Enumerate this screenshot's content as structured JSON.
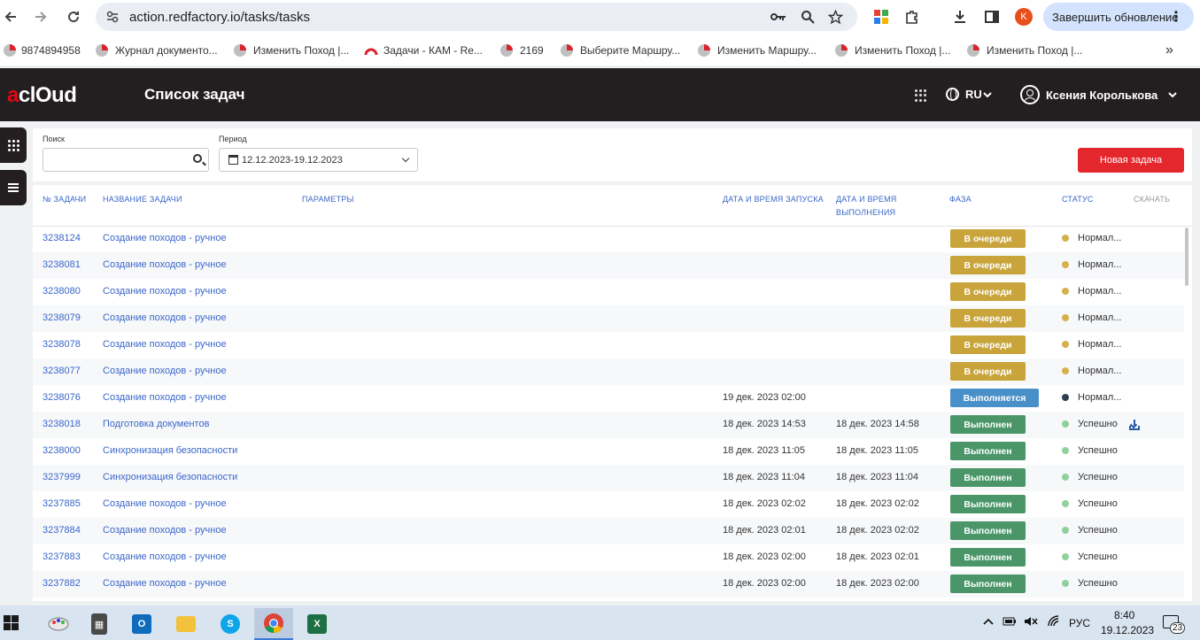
{
  "browser": {
    "url": "action.redfactory.io/tasks/tasks",
    "update_label": "Завершить обновление",
    "profile_initial": "K",
    "bookmarks": [
      {
        "label": "9874894958"
      },
      {
        "label": "Журнал документо..."
      },
      {
        "label": "Изменить Поход |..."
      },
      {
        "label": "Задачи - КАМ - Re..."
      },
      {
        "label": "2169"
      },
      {
        "label": "Выберите Маршру..."
      },
      {
        "label": "Изменить Маршру..."
      },
      {
        "label": "Изменить Поход |..."
      },
      {
        "label": "Изменить Поход |..."
      }
    ],
    "more_label": "»"
  },
  "app": {
    "logo_a": "a",
    "logo_rest": "clOud",
    "title": "Список задач",
    "lang": "RU",
    "user_name": "Ксения Королькова"
  },
  "filters": {
    "search_label": "Поиск",
    "search_value": "",
    "period_label": "Период",
    "period_value": "12.12.2023-19.12.2023",
    "new_task_label": "Новая задача"
  },
  "table": {
    "headers": {
      "id": "№ ЗАДАЧИ",
      "name": "НАЗВАНИЕ ЗАДАЧИ",
      "params": "ПАРАМЕТРЫ",
      "start": "ДАТА И ВРЕМЯ ЗАПУСКА",
      "done_1": "ДАТА И ВРЕМЯ",
      "done_2": "ВЫПОЛНЕНИЯ",
      "phase": "ФАЗА",
      "status": "СТАТУС",
      "download": "СКАЧАТЬ"
    },
    "rows": [
      {
        "id": "3238124",
        "name": "Создание походов - ручное",
        "start": "",
        "done": "",
        "phase": "В очереди",
        "phase_kind": "queue",
        "status": "Нормал...",
        "status_color": "#d6b04a",
        "download": false
      },
      {
        "id": "3238081",
        "name": "Создание походов - ручное",
        "start": "",
        "done": "",
        "phase": "В очереди",
        "phase_kind": "queue",
        "status": "Нормал...",
        "status_color": "#d6b04a",
        "download": false
      },
      {
        "id": "3238080",
        "name": "Создание походов - ручное",
        "start": "",
        "done": "",
        "phase": "В очереди",
        "phase_kind": "queue",
        "status": "Нормал...",
        "status_color": "#d6b04a",
        "download": false
      },
      {
        "id": "3238079",
        "name": "Создание походов - ручное",
        "start": "",
        "done": "",
        "phase": "В очереди",
        "phase_kind": "queue",
        "status": "Нормал...",
        "status_color": "#d6b04a",
        "download": false
      },
      {
        "id": "3238078",
        "name": "Создание походов - ручное",
        "start": "",
        "done": "",
        "phase": "В очереди",
        "phase_kind": "queue",
        "status": "Нормал...",
        "status_color": "#d6b04a",
        "download": false
      },
      {
        "id": "3238077",
        "name": "Создание походов - ручное",
        "start": "",
        "done": "",
        "phase": "В очереди",
        "phase_kind": "queue",
        "status": "Нормал...",
        "status_color": "#d6b04a",
        "download": false
      },
      {
        "id": "3238076",
        "name": "Создание походов - ручное",
        "start": "19 дек. 2023 02:00",
        "done": "",
        "phase": "Выполняется",
        "phase_kind": "running",
        "status": "Нормал...",
        "status_color": "#2c3e50",
        "download": false
      },
      {
        "id": "3238018",
        "name": "Подготовка документов",
        "start": "18 дек. 2023 14:53",
        "done": "18 дек. 2023 14:58",
        "phase": "Выполнен",
        "phase_kind": "done",
        "status": "Успешно",
        "status_color": "#8fd19e",
        "download": true
      },
      {
        "id": "3238000",
        "name": "Синхронизация безопасности",
        "start": "18 дек. 2023 11:05",
        "done": "18 дек. 2023 11:05",
        "phase": "Выполнен",
        "phase_kind": "done",
        "status": "Успешно",
        "status_color": "#8fd19e",
        "download": false
      },
      {
        "id": "3237999",
        "name": "Синхронизация безопасности",
        "start": "18 дек. 2023 11:04",
        "done": "18 дек. 2023 11:04",
        "phase": "Выполнен",
        "phase_kind": "done",
        "status": "Успешно",
        "status_color": "#8fd19e",
        "download": false
      },
      {
        "id": "3237885",
        "name": "Создание походов - ручное",
        "start": "18 дек. 2023 02:02",
        "done": "18 дек. 2023 02:02",
        "phase": "Выполнен",
        "phase_kind": "done",
        "status": "Успешно",
        "status_color": "#8fd19e",
        "download": false
      },
      {
        "id": "3237884",
        "name": "Создание походов - ручное",
        "start": "18 дек. 2023 02:01",
        "done": "18 дек. 2023 02:02",
        "phase": "Выполнен",
        "phase_kind": "done",
        "status": "Успешно",
        "status_color": "#8fd19e",
        "download": false
      },
      {
        "id": "3237883",
        "name": "Создание походов - ручное",
        "start": "18 дек. 2023 02:00",
        "done": "18 дек. 2023 02:01",
        "phase": "Выполнен",
        "phase_kind": "done",
        "status": "Успешно",
        "status_color": "#8fd19e",
        "download": false
      },
      {
        "id": "3237882",
        "name": "Создание походов - ручное",
        "start": "18 дек. 2023 02:00",
        "done": "18 дек. 2023 02:00",
        "phase": "Выполнен",
        "phase_kind": "done",
        "status": "Успешно",
        "status_color": "#8fd19e",
        "download": false
      }
    ]
  },
  "taskbar": {
    "apps": [
      "paint-icon",
      "calculator-icon",
      "outlook-icon",
      "file-explorer-icon",
      "skype-icon",
      "chrome-icon",
      "excel-icon"
    ],
    "lang": "РУС",
    "time": "8:40",
    "date": "19.12.2023",
    "notif_count": "23"
  },
  "colors": {
    "brand_red": "#e3272d",
    "header_bg": "#231f20",
    "link_blue": "#3a66c9",
    "phase_queue": "#c8a43a",
    "phase_running": "#4a90c8",
    "phase_done": "#4a9669"
  }
}
